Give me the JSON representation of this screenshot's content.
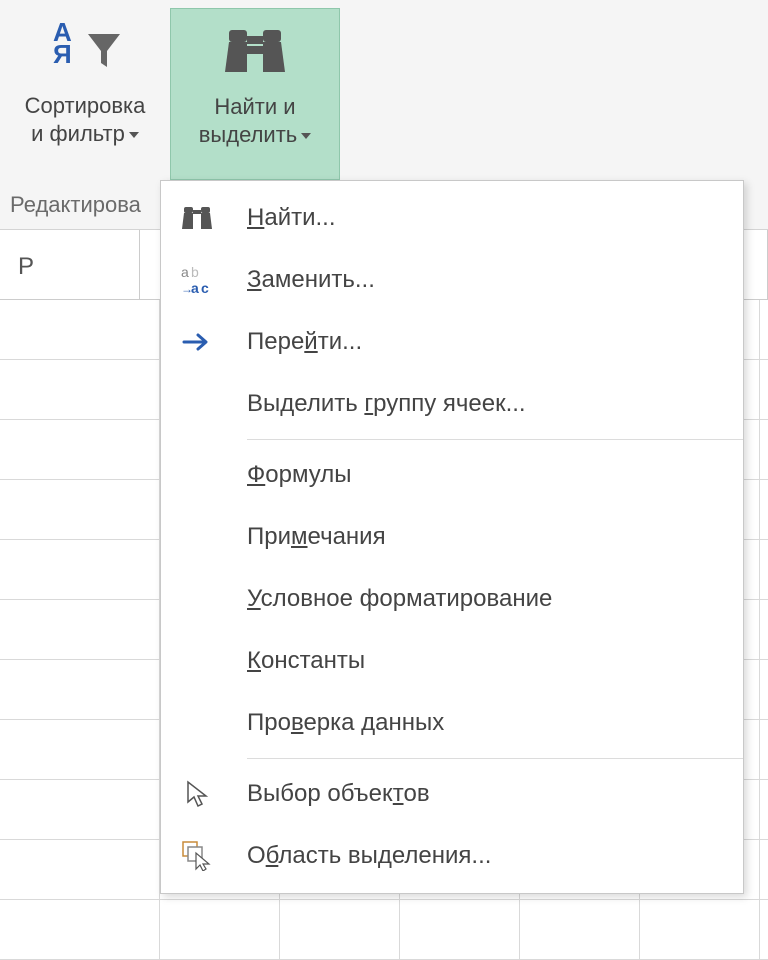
{
  "ribbon": {
    "sort_filter": {
      "line1": "Сортировка",
      "line2": "и фильтр"
    },
    "find_select": {
      "line1": "Найти и",
      "line2": "выделить"
    },
    "group_label": "Редактирова"
  },
  "column_headers": [
    "P"
  ],
  "menu": {
    "find": "айти...",
    "find_u": "Н",
    "replace": "аменить...",
    "replace_u": "З",
    "goto_pre": "Пере",
    "goto_u": "й",
    "goto_post": "ти...",
    "goto_special_pre": "Выделить ",
    "goto_special_u": "г",
    "goto_special_post": "руппу ячеек...",
    "formulas_u": "Ф",
    "formulas": "ормулы",
    "comments_pre": "При",
    "comments_u": "м",
    "comments_post": "ечания",
    "cond_u": "У",
    "cond": "словное форматирование",
    "const_u": "К",
    "const": "онстанты",
    "data_val_pre": "Про",
    "data_val_u": "в",
    "data_val_post": "ерка данных",
    "sel_obj_pre": "Выбор объек",
    "sel_obj_u": "т",
    "sel_obj_post": "ов",
    "sel_pane_pre": "О",
    "sel_pane_u": "б",
    "sel_pane_post": "ласть выделения..."
  }
}
